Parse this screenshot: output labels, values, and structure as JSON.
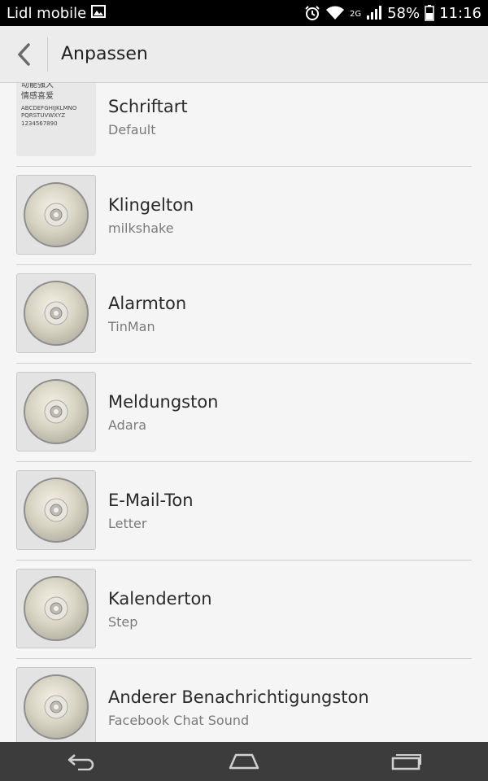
{
  "status_bar": {
    "carrier": "Lidl mobile",
    "network": "2G",
    "battery": "58%",
    "time": "11:16"
  },
  "header": {
    "title": "Anpassen"
  },
  "items": [
    {
      "title": "Schriftart",
      "subtitle": "Default",
      "thumb": "font-preview",
      "preview_lines": [
        "动能强大",
        "情感喜爱",
        "ABCDEFGHIJKLMNO",
        "PQRSTUVWXYZ",
        "1234567890"
      ]
    },
    {
      "title": "Klingelton",
      "subtitle": "milkshake",
      "thumb": "cd-disc-icon"
    },
    {
      "title": "Alarmton",
      "subtitle": "TinMan",
      "thumb": "cd-disc-icon"
    },
    {
      "title": "Meldungston",
      "subtitle": "Adara",
      "thumb": "cd-disc-icon"
    },
    {
      "title": "E-Mail-Ton",
      "subtitle": "Letter",
      "thumb": "cd-disc-icon"
    },
    {
      "title": "Kalenderton",
      "subtitle": "Step",
      "thumb": "cd-disc-icon"
    },
    {
      "title": "Anderer Benachrichtigungston",
      "subtitle": "Facebook Chat Sound",
      "thumb": "cd-disc-icon"
    }
  ],
  "nav_bar": {
    "icons": [
      "back-icon",
      "home-icon",
      "recent-apps-icon"
    ]
  }
}
